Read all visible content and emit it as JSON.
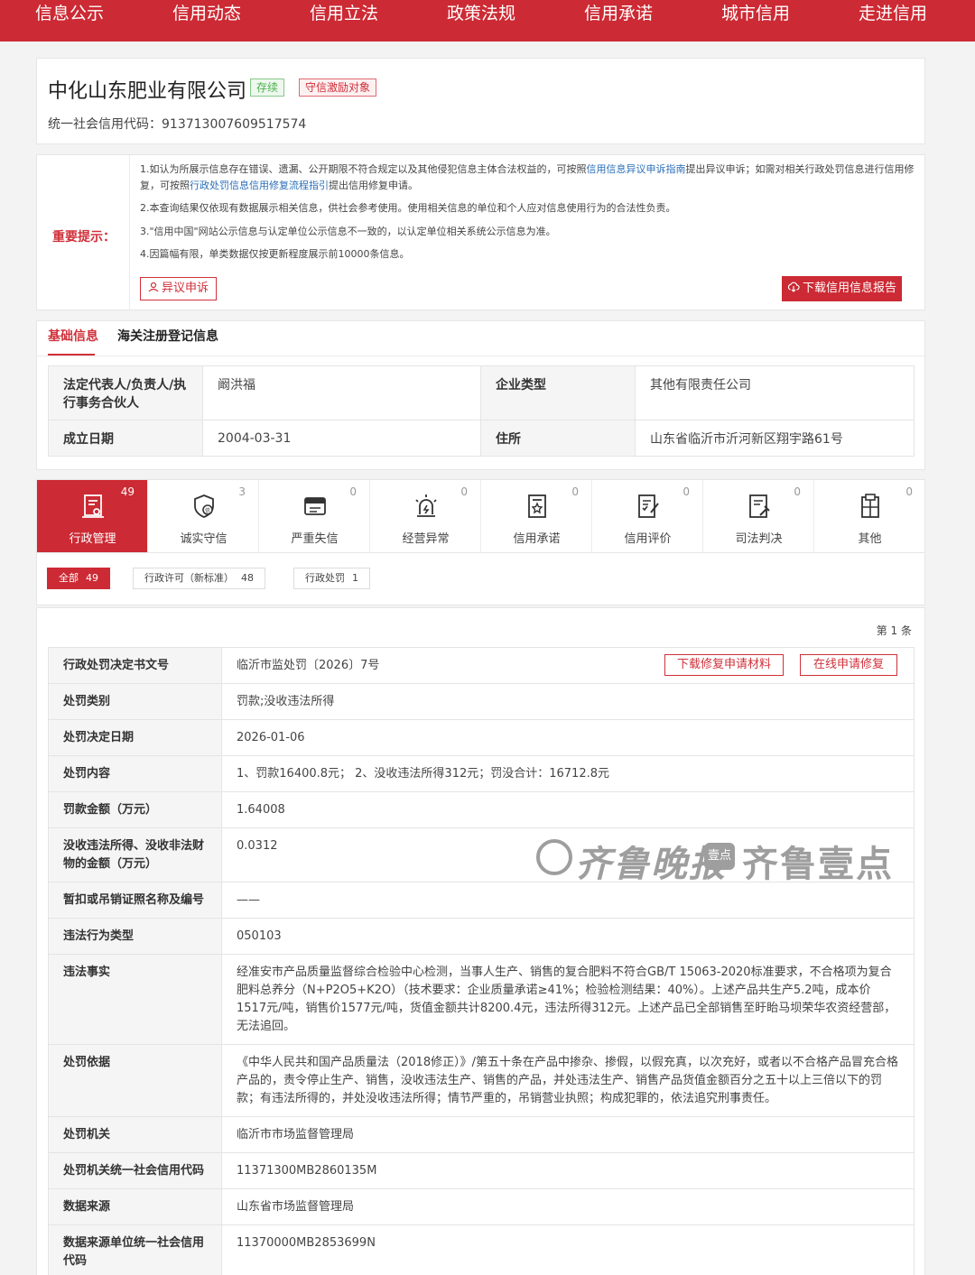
{
  "nav": {
    "items": [
      "信息公示",
      "信用动态",
      "信用立法",
      "政策法规",
      "信用承诺",
      "城市信用",
      "走进信用"
    ]
  },
  "company": {
    "name": "中化山东肥业有限公司",
    "status_badge": "存续",
    "incentive_badge": "守信激励对象",
    "credit_code_label": "统一社会信用代码：",
    "credit_code": "913713007609517574"
  },
  "notice": {
    "title": "重要提示：",
    "line1_part1": "1.如认为所展示信息存在错误、遗漏、公开期限不符合规定以及其他侵犯信息主体合法权益的，可按照",
    "line1_link1": "信用信息异议申诉指南",
    "line1_part2": "提出异议申诉；如需对相关行政处罚信息进行信用修复，可按照",
    "line1_link2": "行政处罚信息信用修复流程指引",
    "line1_part3": "提出信用修复申请。",
    "line2": "2.本查询结果仅依现有数据展示相关信息，供社会参考使用。使用相关信息的单位和个人应对信息使用行为的合法性负责。",
    "line3": "3.\"信用中国\"网站公示信息与认定单位公示信息不一致的，以认定单位相关系统公示信息为准。",
    "line4": "4.因篇幅有限，单类数据仅按更新程度展示前10000条信息。",
    "objection_button": "异议申诉",
    "download_button": "下载信用信息报告"
  },
  "basic": {
    "tab_active": "基础信息",
    "tab_other": "海关注册登记信息",
    "rows": [
      {
        "k1": "法定代表人/负责人/执行事务合伙人",
        "v1": "阚洪福",
        "k2": "企业类型",
        "v2": "其他有限责任公司"
      },
      {
        "k1": "成立日期",
        "v1": "2004-03-31",
        "k2": "住所",
        "v2": "山东省临沂市沂河新区翔宇路61号"
      }
    ]
  },
  "categories": [
    {
      "label": "行政管理",
      "count": "49",
      "icon": "admin-icon"
    },
    {
      "label": "诚实守信",
      "count": "3",
      "icon": "honesty-icon"
    },
    {
      "label": "严重失信",
      "count": "0",
      "icon": "dishonesty-icon"
    },
    {
      "label": "经营异常",
      "count": "0",
      "icon": "alarm-icon"
    },
    {
      "label": "信用承诺",
      "count": "0",
      "icon": "commitment-icon"
    },
    {
      "label": "信用评价",
      "count": "0",
      "icon": "evaluation-icon"
    },
    {
      "label": "司法判决",
      "count": "0",
      "icon": "judgment-icon"
    },
    {
      "label": "其他",
      "count": "0",
      "icon": "other-icon"
    }
  ],
  "filters": [
    {
      "label": "全部",
      "count": "49"
    },
    {
      "label": "行政许可（新标准）",
      "count": "48"
    },
    {
      "label": "行政处罚",
      "count": "1"
    }
  ],
  "record": {
    "page_count": "第 1 条",
    "download_repair_button": "下载修复申请材料",
    "online_repair_button": "在线申请修复",
    "rows": [
      {
        "k": "行政处罚决定书文号",
        "v": "临沂市监处罚〔2026〕7号"
      },
      {
        "k": "处罚类别",
        "v": "罚款;没收违法所得"
      },
      {
        "k": "处罚决定日期",
        "v": "2026-01-06"
      },
      {
        "k": "处罚内容",
        "v": "1、罚款16400.8元； 2、没收违法所得312元；罚没合计：16712.8元"
      },
      {
        "k": "罚款金额（万元）",
        "v": "1.64008"
      },
      {
        "k": "没收违法所得、没收非法财物的金额（万元）",
        "v": "0.0312"
      },
      {
        "k": "暂扣或吊销证照名称及编号",
        "v": "——"
      },
      {
        "k": "违法行为类型",
        "v": "050103"
      },
      {
        "k": "违法事实",
        "v": "经准安市产品质量监督综合检验中心检测，当事人生产、销售的复合肥料不符合GB/T 15063-2020标准要求，不合格项为复合肥料总养分（N+P2O5+K2O）（技术要求：企业质量承诺≥41%；检验检测结果：40%）。上述产品共生产5.2吨，成本价1517元/吨，销售价1577元/吨，货值金额共计8200.4元，违法所得312元。上述产品已全部销售至盱眙马坝荣华农资经营部，无法追回。"
      },
      {
        "k": "处罚依据",
        "v": "《中华人民共和国产品质量法（2018修正）》/第五十条在产品中掺杂、掺假，以假充真，以次充好，或者以不合格产品冒充合格产品的，责令停止生产、销售，没收违法生产、销售的产品，并处违法生产、销售产品货值金额百分之五十以上三倍以下的罚款；有违法所得的，并处没收违法所得；情节严重的，吊销营业执照；构成犯罪的，依法追究刑事责任。"
      },
      {
        "k": "处罚机关",
        "v": "临沂市市场监督管理局"
      },
      {
        "k": "处罚机关统一社会信用代码",
        "v": "11371300MB2860135M"
      },
      {
        "k": "数据来源",
        "v": "山东省市场监督管理局"
      },
      {
        "k": "数据来源单位统一社会信用代码",
        "v": "11370000MB2853699N"
      }
    ]
  },
  "watermark": {
    "brand1": "齐鲁晚报",
    "brand2_badge": "壹点",
    "brand2": "齐鲁壹点"
  }
}
